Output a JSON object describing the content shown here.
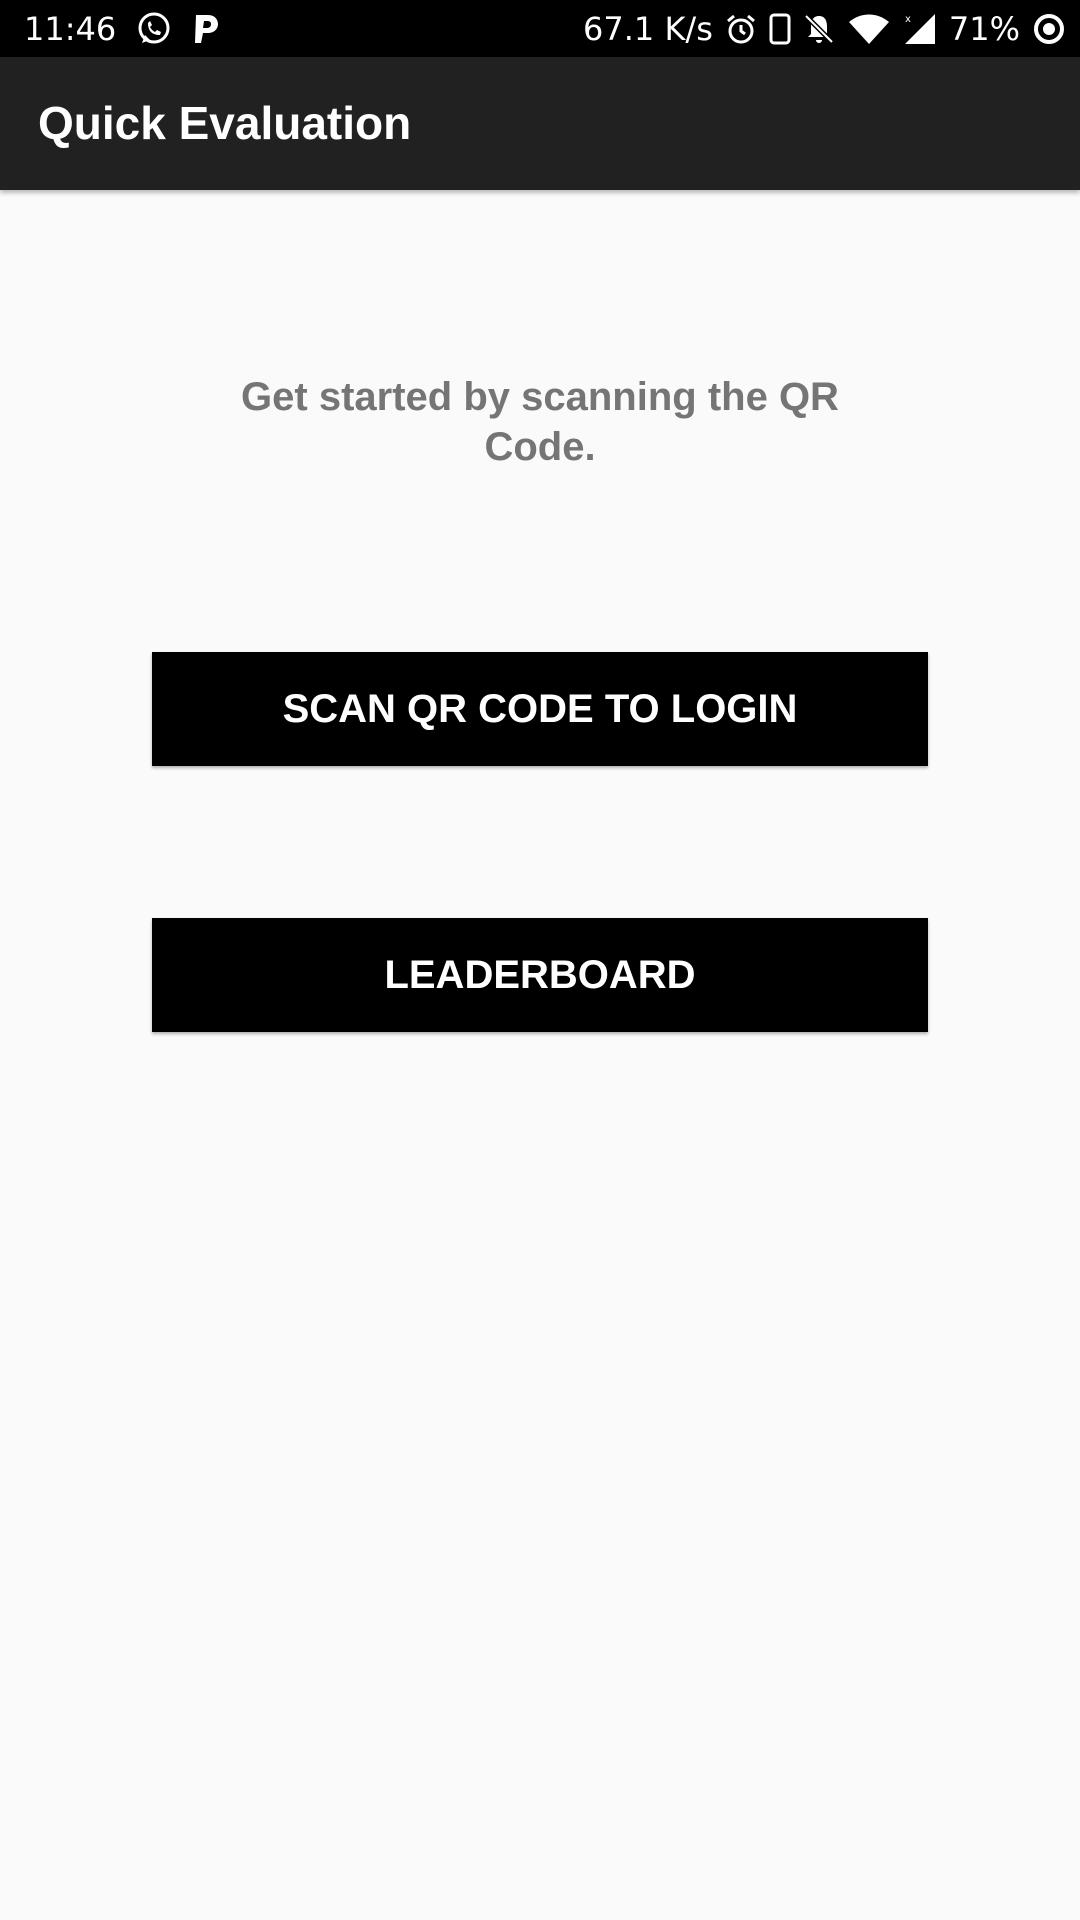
{
  "status_bar": {
    "time": "11:46",
    "net_speed": "67.1 K/s",
    "battery_percent": "71%",
    "left_icons": [
      "whatsapp-icon",
      "p-icon"
    ],
    "right_icons": [
      "alarm-icon",
      "phone-icon",
      "bell-off-icon",
      "wifi-icon",
      "signal-icon",
      "battery-ring-icon"
    ]
  },
  "app_bar": {
    "title": "Quick Evaluation"
  },
  "main": {
    "intro_text": "Get started by scanning the QR Code.",
    "scan_button_label": "SCAN QR CODE TO LOGIN",
    "leaderboard_button_label": "LEADERBOARD"
  },
  "colors": {
    "status_bar_bg": "#000000",
    "app_bar_bg": "#212121",
    "page_bg": "#fafafa",
    "button_bg": "#000000",
    "button_text": "#ffffff",
    "intro_text": "#757575"
  }
}
